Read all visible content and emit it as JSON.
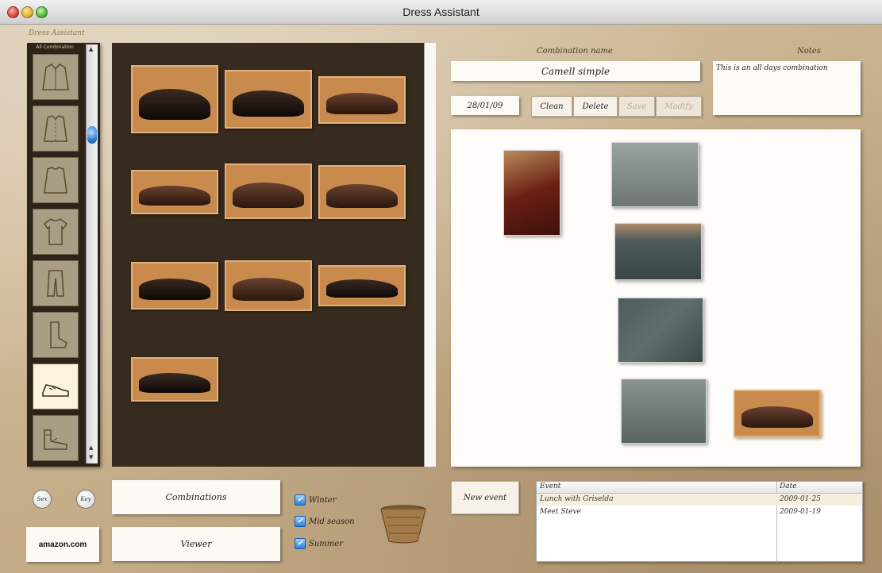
{
  "window": {
    "title": "Dress Assistant",
    "brand": "Dress Assistant"
  },
  "categories": {
    "header": "All Combination",
    "items": [
      {
        "name": "jacket",
        "icon": "jacket-icon"
      },
      {
        "name": "shirt",
        "icon": "shirt-icon"
      },
      {
        "name": "sweater",
        "icon": "sweater-icon"
      },
      {
        "name": "tshirt",
        "icon": "tshirt-icon"
      },
      {
        "name": "trousers",
        "icon": "trousers-icon"
      },
      {
        "name": "socks",
        "icon": "sock-icon"
      },
      {
        "name": "shoes",
        "icon": "shoe-icon",
        "selected": true
      },
      {
        "name": "sandals",
        "icon": "sandal-icon"
      }
    ]
  },
  "combination": {
    "name_label": "Combination name",
    "name_value": "Camell simple",
    "date": "28/01/09",
    "notes_label": "Notes",
    "notes_value": "This is an all days combination"
  },
  "toolbar": {
    "clean": "Clean",
    "delete": "Delete",
    "save": "Save",
    "modify": "Modify"
  },
  "bottom": {
    "sex_label": "Sex",
    "key_label": "Key",
    "amazon_label": "amazon.com",
    "combinations_label": "Combinations",
    "viewer_label": "Viewer",
    "seasons": [
      {
        "label": "Winter",
        "checked": true
      },
      {
        "label": "Mid season",
        "checked": true
      },
      {
        "label": "Summer",
        "checked": true
      }
    ],
    "new_event_label": "New event"
  },
  "events": {
    "columns": [
      "Event",
      "Date"
    ],
    "rows": [
      {
        "event": "Lunch with Griselda",
        "date": "2009-01-25"
      },
      {
        "event": "Meet Steve",
        "date": "2009-01-19"
      }
    ]
  }
}
